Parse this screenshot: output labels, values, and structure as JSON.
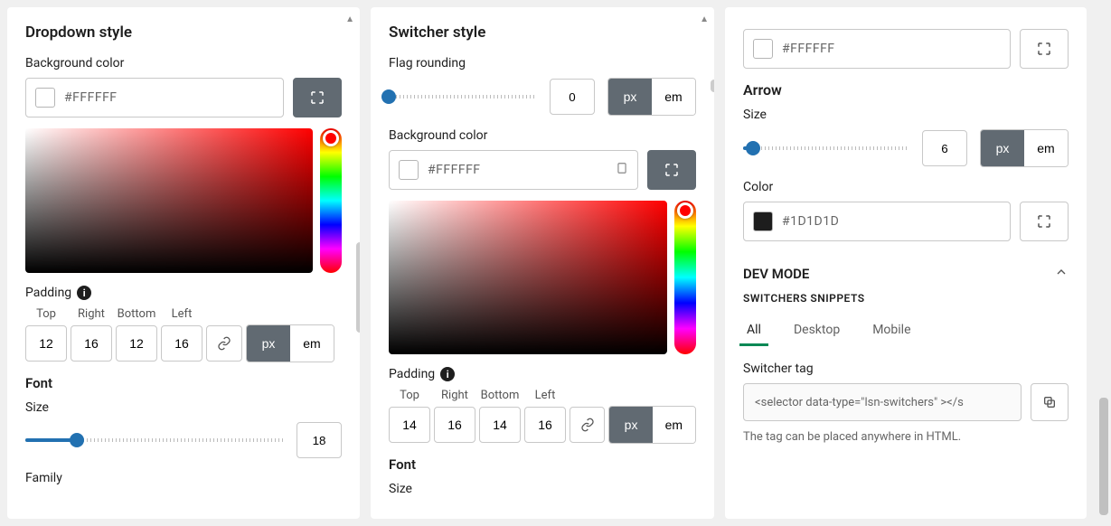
{
  "left": {
    "title": "Dropdown style",
    "bg_label": "Background color",
    "bg_value": "#FFFFFF",
    "padding_label": "Padding",
    "pad_cols": {
      "top": "Top",
      "right": "Right",
      "bottom": "Bottom",
      "left": "Left"
    },
    "pad_vals": {
      "top": "12",
      "right": "16",
      "bottom": "12",
      "left": "16"
    },
    "unit": {
      "px": "px",
      "em": "em"
    },
    "font_title": "Font",
    "size_label": "Size",
    "size_value": "18",
    "family_label": "Family"
  },
  "mid": {
    "title": "Switcher style",
    "flag_label": "Flag rounding",
    "flag_value": "0",
    "unit": {
      "px": "px",
      "em": "em"
    },
    "bg_label": "Background color",
    "bg_value": "#FFFFFF",
    "padding_label": "Padding",
    "pad_cols": {
      "top": "Top",
      "right": "Right",
      "bottom": "Bottom",
      "left": "Left"
    },
    "pad_vals": {
      "top": "14",
      "right": "16",
      "bottom": "14",
      "left": "16"
    },
    "font_title": "Font",
    "size_label": "Size"
  },
  "right": {
    "bg_value": "#FFFFFF",
    "arrow_title": "Arrow",
    "size_label": "Size",
    "size_value": "6",
    "unit": {
      "px": "px",
      "em": "em"
    },
    "color_label": "Color",
    "color_value": "#1D1D1D",
    "dev_title": "DEV MODE",
    "dev_sub": "SWITCHERS SNIPPETS",
    "tabs": {
      "all": "All",
      "desktop": "Desktop",
      "mobile": "Mobile"
    },
    "tag_label": "Switcher tag",
    "tag_value": "<selector data-type=\"lsn-switchers\" ></s",
    "tag_hint": "The tag can be placed anywhere in HTML."
  }
}
